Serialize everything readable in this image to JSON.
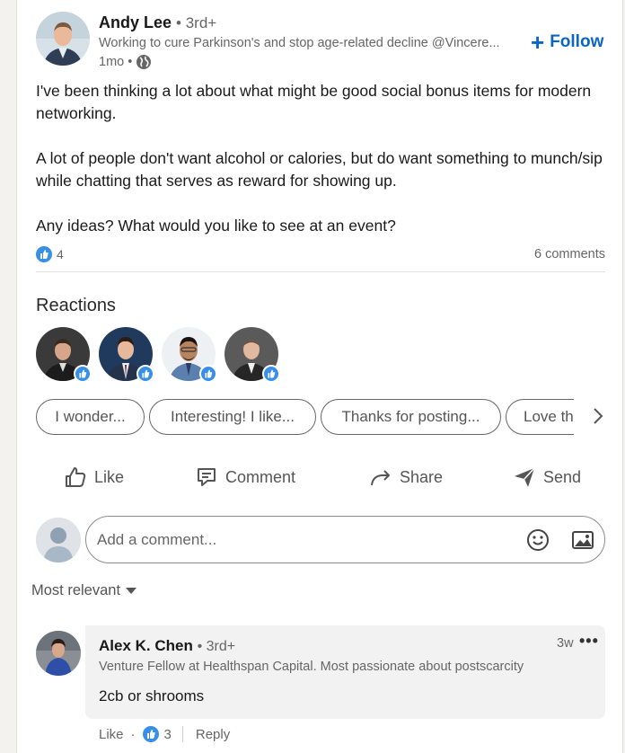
{
  "post": {
    "author_name": "Andy Lee",
    "author_degree": "• 3rd+",
    "author_headline": "Working to cure Parkinson's and stop age-related decline @Vincere...",
    "time": "1mo •",
    "follow_label": "Follow",
    "paragraphs": [
      "I've been thinking a lot about what might be good social bonus items for modern networking.",
      "A lot of people don't want alcohol or calories, but do want something to munch/sip while chatting that serves as reward for showing up.",
      "Any ideas? What would you like to see at an event?"
    ],
    "reaction_count": "4",
    "comments_count": "6 comments"
  },
  "reactions": {
    "title": "Reactions"
  },
  "suggestions": [
    "I wonder...",
    "Interesting! I like...",
    "Thanks for posting...",
    "Love th"
  ],
  "actions": {
    "like": "Like",
    "comment": "Comment",
    "share": "Share",
    "send": "Send"
  },
  "comment_input": {
    "placeholder": "Add a comment..."
  },
  "sort": {
    "label": "Most relevant"
  },
  "comment": {
    "author_name": "Alex K. Chen",
    "author_degree": "• 3rd+",
    "time": "3w",
    "more": "•••",
    "headline": "Venture Fellow at Healthspan Capital. Most passionate about postscarcity",
    "text": "2cb or shrooms",
    "like_label": "Like",
    "dot": "·",
    "like_count": "3",
    "reply_label": "Reply"
  },
  "colors": {
    "accent": "#0a66c2",
    "like_blue": "#378fe9"
  }
}
